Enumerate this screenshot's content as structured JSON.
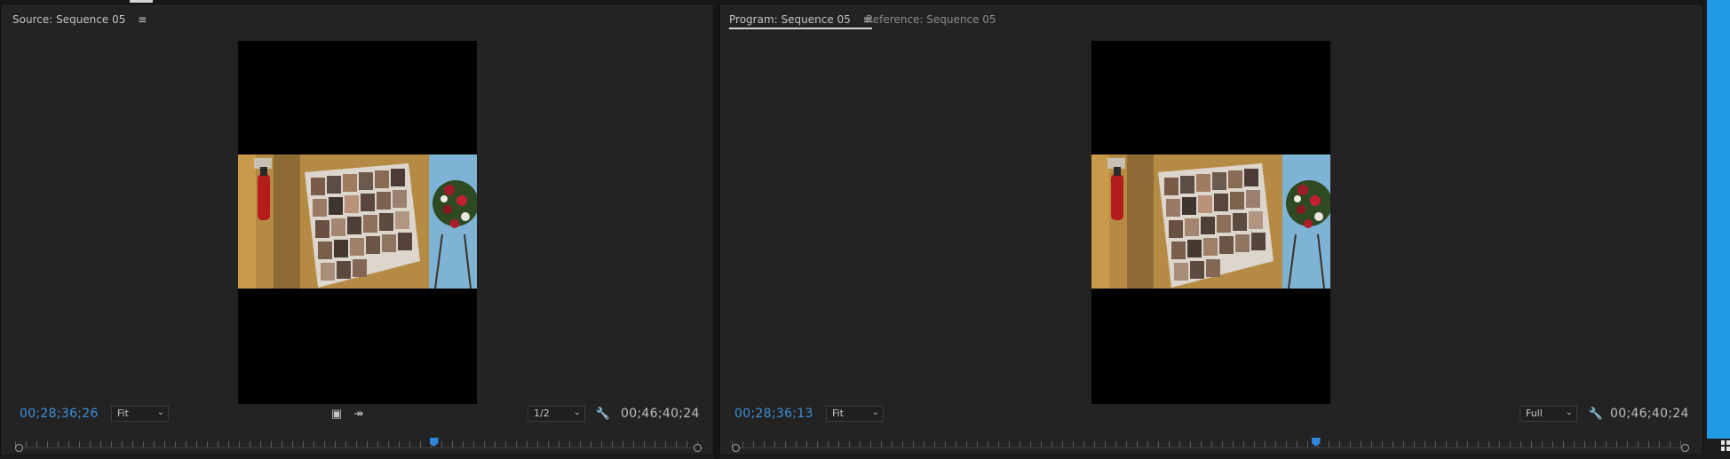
{
  "source": {
    "tab": {
      "label": "Source: Sequence 05",
      "menu_glyph": "≡"
    },
    "current_timecode": "00;28;36;26",
    "zoom": "Fit",
    "resolution": "1/2",
    "total_duration": "00;46;40;24",
    "buttons": {
      "export_frame_glyph": "▣",
      "insert_glyph": "↠",
      "settings_glyph": "🔧"
    },
    "playhead_position_fraction": 0.61
  },
  "program": {
    "tab": {
      "label": "Program: Sequence 05",
      "menu_glyph": "≡"
    },
    "reference_tab": {
      "label": "Reference: Sequence 05"
    },
    "current_timecode": "00;28;36;13",
    "zoom": "Fit",
    "resolution": "Full",
    "total_duration": "00;46;40;24",
    "buttons": {
      "settings_glyph": "🔧"
    },
    "playhead_position_fraction": 0.61
  },
  "dropdown_chevron": "⌄",
  "colors": {
    "accent_timecode": "#3d8fdb",
    "playhead": "#2f86dc",
    "system_strip": "#1f9be6"
  }
}
